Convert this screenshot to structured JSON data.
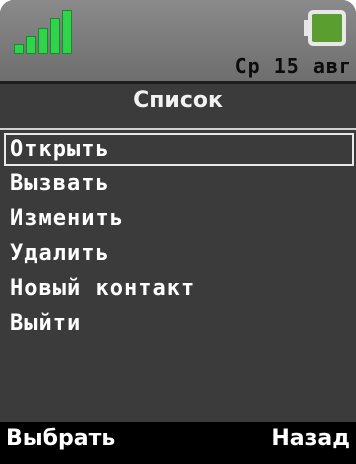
{
  "status": {
    "signal_level": 5,
    "signal_max": 5,
    "signal_icon": "signal-strength-icon",
    "battery_icon": "battery-icon",
    "battery_level": 1.0,
    "date": "Ср 15 авг",
    "accent_color": "#2fd44a",
    "battery_color": "#5a9e2f"
  },
  "title": "Список",
  "menu": {
    "selected_index": 0,
    "items": [
      {
        "label": "Открыть"
      },
      {
        "label": "Вызвать"
      },
      {
        "label": "Изменить"
      },
      {
        "label": "Удалить"
      },
      {
        "label": "Новый контакт"
      },
      {
        "label": "Выйти"
      }
    ]
  },
  "softkeys": {
    "left": "Выбрать",
    "right": "Назад"
  }
}
